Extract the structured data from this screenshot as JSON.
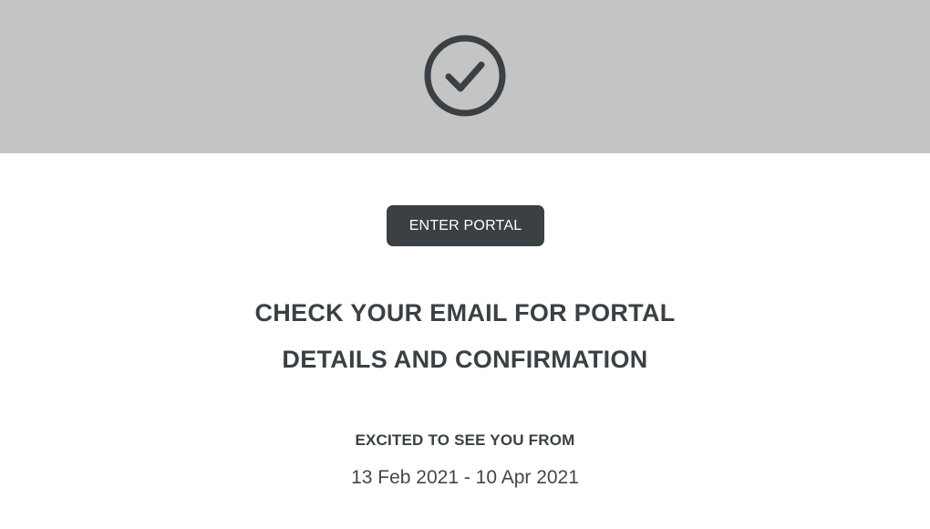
{
  "banner": {
    "icon": "check-circle-icon",
    "background_color": "#c4c4c4",
    "icon_color": "#3a4043"
  },
  "actions": {
    "enter_portal_label": "ENTER PORTAL"
  },
  "message": {
    "line1": "CHECK YOUR EMAIL FOR PORTAL",
    "line2": "DETAILS AND CONFIRMATION"
  },
  "stay": {
    "label": "EXCITED TO SEE YOU FROM",
    "dates": "13 Feb 2021 - 10 Apr 2021"
  },
  "colors": {
    "accent": "#3a4043",
    "page_background": "#ffffff"
  }
}
